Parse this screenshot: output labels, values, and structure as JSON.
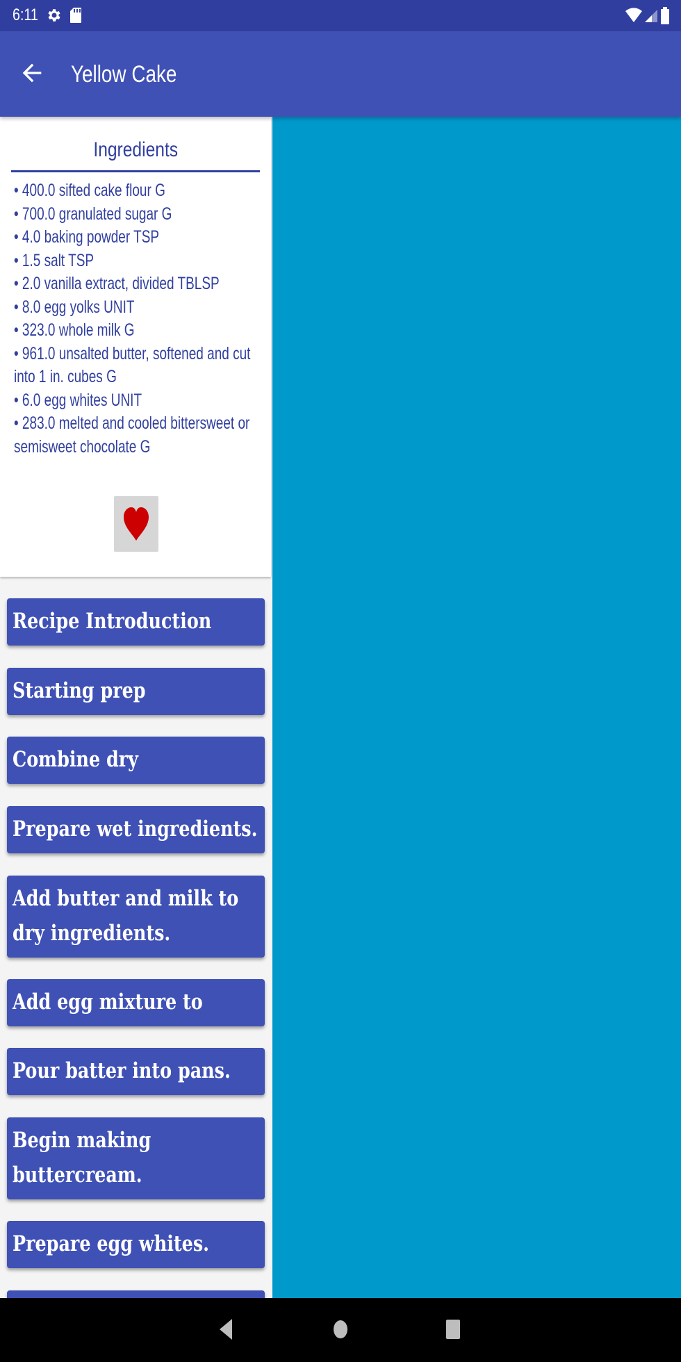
{
  "status_bar": {
    "time": "6:11",
    "icons": [
      "gear-icon",
      "sd-card-icon",
      "wifi-icon",
      "cell-signal-icon",
      "battery-icon"
    ]
  },
  "app_bar": {
    "title": "Yellow Cake",
    "back_icon": "arrow-back-icon"
  },
  "ingredients": {
    "title": "Ingredients",
    "items": [
      "• 400.0 sifted cake flour G",
      "• 700.0 granulated sugar G",
      "• 4.0 baking powder TSP",
      "• 1.5 salt TSP",
      "• 2.0 vanilla extract, divided TBLSP",
      "• 8.0 egg yolks UNIT",
      "• 323.0 whole milk G",
      "• 961.0 unsalted butter, softened and cut into 1 in. cubes G",
      "• 6.0 egg whites UNIT",
      "• 283.0 melted and cooled bittersweet or semisweet chocolate G"
    ],
    "favorite_icon": "heart-icon"
  },
  "steps": [
    "Recipe Introduction",
    "Starting prep",
    "Combine dry",
    "Prepare wet ingredients.",
    "Add butter and milk to dry ingredients.",
    "Add egg mixture to",
    "Pour batter into pans.",
    "Begin making buttercream.",
    "Prepare egg whites.",
    ""
  ],
  "colors": {
    "status_bar": "#303f9f",
    "primary": "#3f51b5",
    "detail_background": "#0099cc",
    "heart": "#cc0000"
  },
  "nav_bar": {
    "icons": [
      "nav-back-icon",
      "nav-home-icon",
      "nav-recents-icon"
    ]
  }
}
